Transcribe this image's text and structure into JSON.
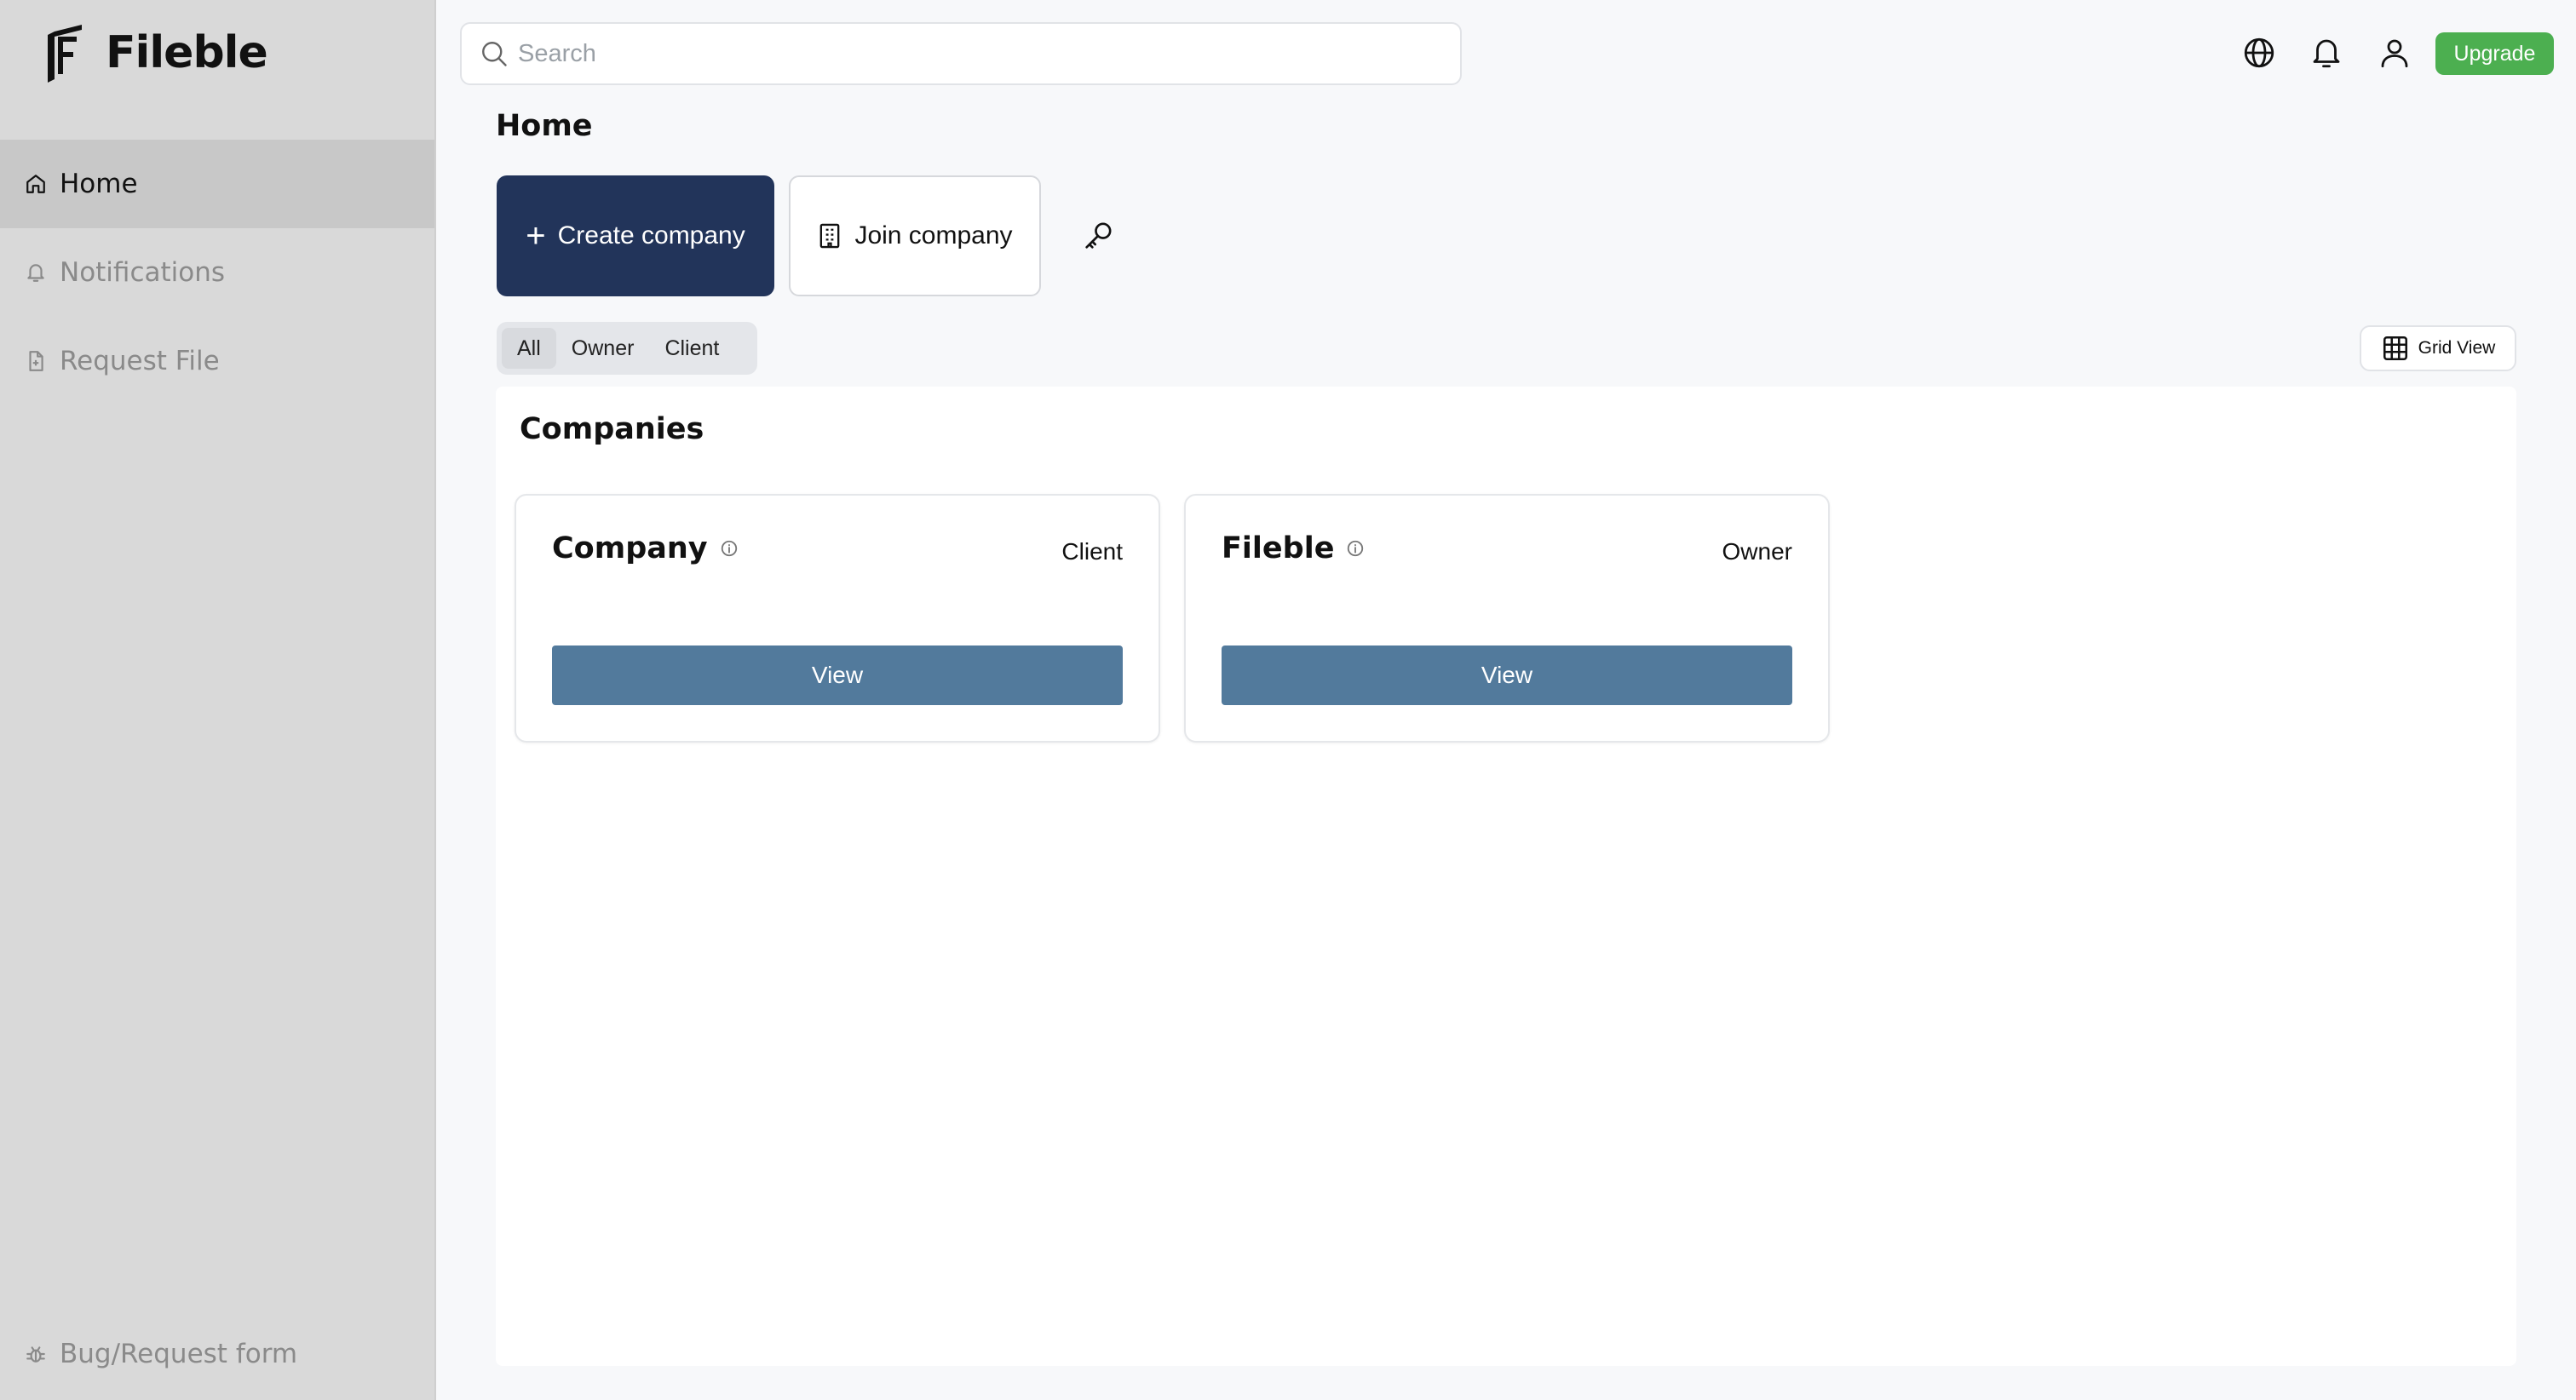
{
  "brand": {
    "name": "Fileble",
    "logo_icon": "fileble-logo-icon"
  },
  "sidebar": {
    "items": [
      {
        "label": "Home",
        "icon": "home-icon",
        "active": true
      },
      {
        "label": "Notifications",
        "icon": "bell-icon",
        "active": false
      },
      {
        "label": "Request File",
        "icon": "file-request-icon",
        "active": false
      }
    ],
    "footer": {
      "label": "Bug/Request form",
      "icon": "bug-icon"
    }
  },
  "topbar": {
    "search_placeholder": "Search",
    "icons": [
      "globe-icon",
      "bell-icon",
      "user-icon"
    ],
    "upgrade_label": "Upgrade"
  },
  "main": {
    "title": "Home",
    "create_label": "Create company",
    "join_label": "Join company",
    "key_icon": "key-icon",
    "filters": [
      "All",
      "Owner",
      "Client"
    ],
    "active_filter": "All",
    "view_toggle_label": "Grid View",
    "section_title": "Companies",
    "companies": [
      {
        "name": "Company",
        "role": "Client",
        "view_label": "View"
      },
      {
        "name": "Fileble",
        "role": "Owner",
        "view_label": "View"
      }
    ]
  },
  "colors": {
    "sidebar_bg": "#d9d9d9",
    "primary_dark": "#22345a",
    "view_button": "#527a9c",
    "upgrade": "#4caf50"
  }
}
